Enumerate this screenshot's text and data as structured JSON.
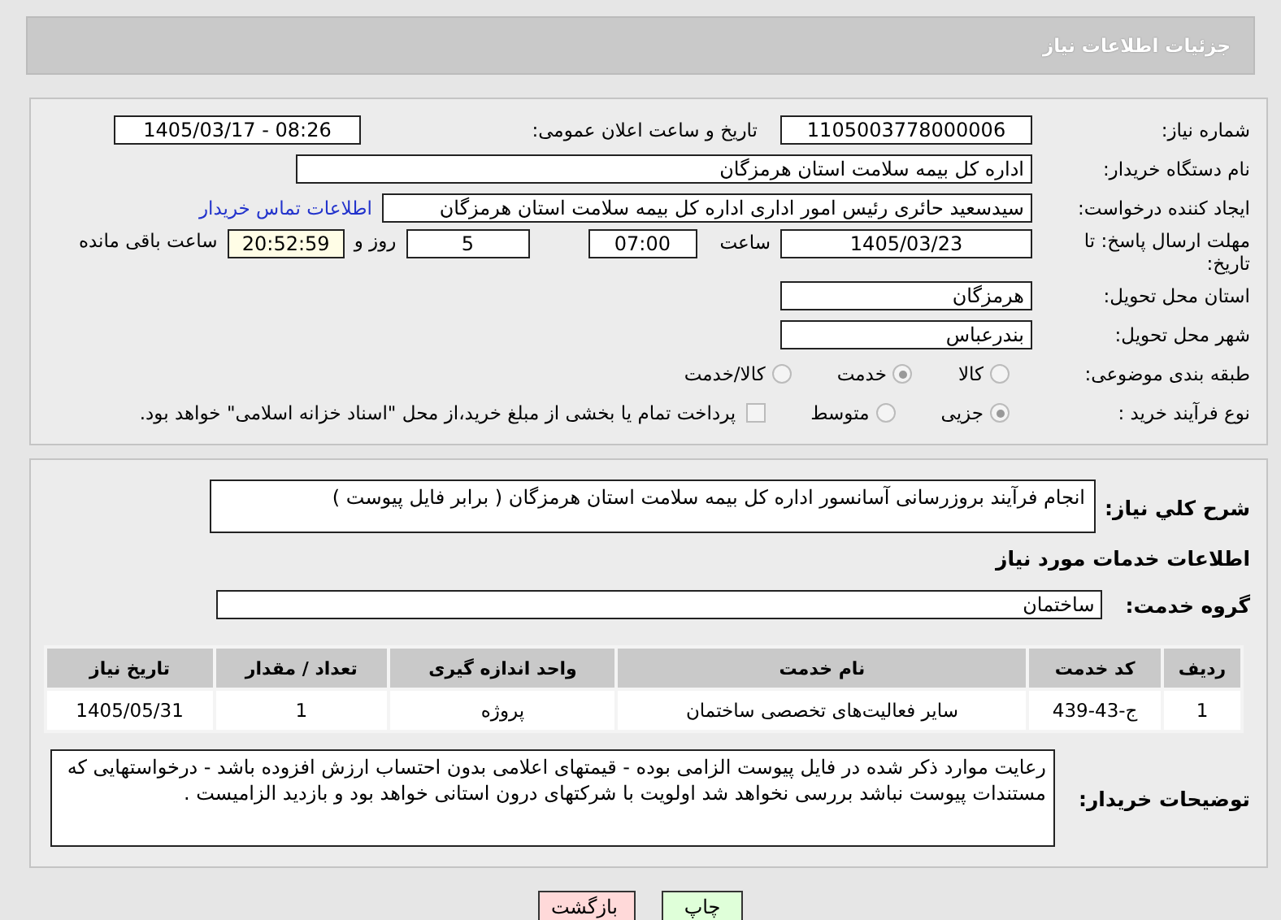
{
  "header": {
    "title": "جزئیات اطلاعات نیاز"
  },
  "need_info": {
    "need_number": {
      "label": "شماره نیاز:",
      "value": "1105003778000006"
    },
    "announce": {
      "label": "تاریخ و ساعت اعلان عمومی:",
      "value": "1405/03/17 - 08:26"
    },
    "buyer_org": {
      "label": "نام دستگاه خریدار:",
      "value": "اداره کل بیمه سلامت استان هرمزگان"
    },
    "requester": {
      "label": "ایجاد کننده درخواست:",
      "value": "سیدسعید حائری رئیس امور اداری اداره کل بیمه سلامت استان هرمزگان",
      "link": "اطلاعات تماس خریدار"
    },
    "deadline": {
      "label": "مهلت ارسال پاسخ: تا تاریخ:",
      "date": "1405/03/23",
      "time_label": "ساعت",
      "time": "07:00",
      "days": "5",
      "days_label": "روز و",
      "remaining": "20:52:59",
      "remaining_label": "ساعت باقی مانده"
    },
    "province": {
      "label": "استان محل تحویل:",
      "value": "هرمزگان"
    },
    "city": {
      "label": "شهر محل تحویل:",
      "value": "بندرعباس"
    },
    "category": {
      "label": "طبقه بندی موضوعی:",
      "options": [
        {
          "label": "کالا",
          "selected": false
        },
        {
          "label": "خدمت",
          "selected": true
        },
        {
          "label": "کالا/خدمت",
          "selected": false
        }
      ]
    },
    "process": {
      "label": "نوع فرآیند خرید :",
      "options": [
        {
          "label": "جزیی",
          "selected": true
        },
        {
          "label": "متوسط",
          "selected": false
        }
      ],
      "payment": {
        "label": "پرداخت تمام یا بخشی از مبلغ خرید،از محل \"اسناد خزانه اسلامی\" خواهد بود.",
        "checked": false
      }
    }
  },
  "details": {
    "description": {
      "label": "شرح کلي نياز:",
      "value": "انجام فرآیند بروزرسانی آسانسور اداره کل بیمه سلامت استان هرمزگان ( برابر فایل پیوست )"
    },
    "services_heading": "اطلاعات خدمات مورد نیاز",
    "service_group": {
      "label": "گروه خدمت:",
      "value": "ساختمان"
    },
    "table": {
      "columns": [
        "ردیف",
        "کد خدمت",
        "نام خدمت",
        "واحد اندازه گیری",
        "تعداد / مقدار",
        "تاریخ نیاز"
      ],
      "rows": [
        [
          "1",
          "ج-43-439",
          "سایر فعالیت‌های تخصصی ساختمان",
          "پروژه",
          "1",
          "1405/05/31"
        ]
      ]
    },
    "buyer_notes": {
      "label": "توضیحات خریدار:",
      "value": "رعایت موارد ذکر شده در فایل پیوست الزامی بوده - قیمتهای اعلامی بدون احتساب ارزش افزوده باشد - درخواستهایی که مستندات پیوست نباشد بررسی نخواهد شد اولویت با شرکتهای درون استانی خواهد بود و بازدید الزامیست ."
    }
  },
  "buttons": [
    {
      "label": "چاپ",
      "kind": "print"
    },
    {
      "label": "بازگشت",
      "kind": "back"
    }
  ]
}
